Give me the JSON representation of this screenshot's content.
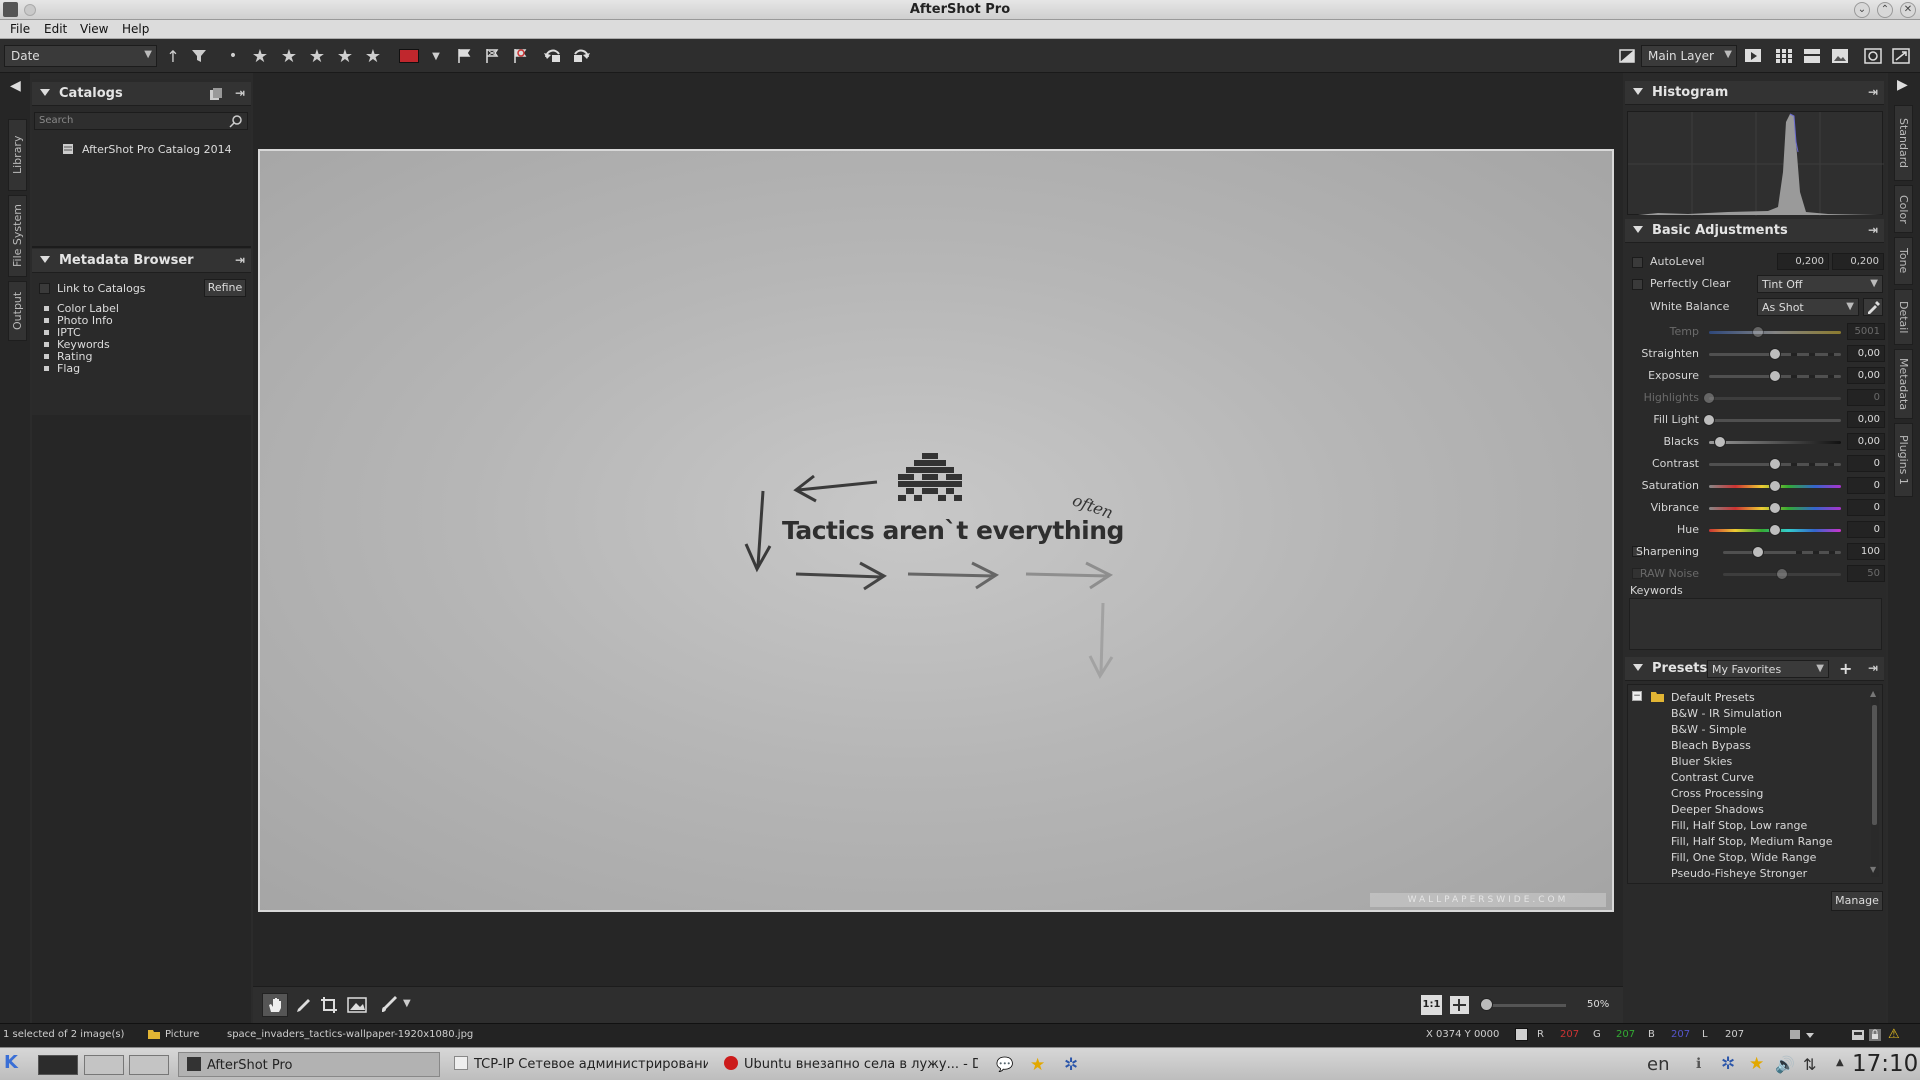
{
  "window": {
    "title": "AfterShot Pro"
  },
  "menu": [
    "File",
    "Edit",
    "View",
    "Help"
  ],
  "toolbar": {
    "sort_value": "Date",
    "layer_value": "Main Layer",
    "label_color": "#c0272d"
  },
  "left_tabs": [
    "Library",
    "File System",
    "Output"
  ],
  "right_tabs": [
    "Standard",
    "Color",
    "Tone",
    "Detail",
    "Metadata",
    "Plugins 1"
  ],
  "catalogs": {
    "title": "Catalogs",
    "search_placeholder": "Search",
    "items": [
      "AfterShot Pro Catalog 2014"
    ]
  },
  "metadata_browser": {
    "title": "Metadata Browser",
    "link_label": "Link to Catalogs",
    "refine_label": "Refine",
    "items": [
      "Color Label",
      "Photo Info",
      "IPTC",
      "Keywords",
      "Rating",
      "Flag"
    ]
  },
  "image": {
    "tagline": "Tactics aren`t everything",
    "often": "often",
    "watermark": "WALLPAPERSWIDE.COM"
  },
  "histogram": {
    "title": "Histogram"
  },
  "basic_adjustments": {
    "title": "Basic Adjustments",
    "autolevel": {
      "label": "AutoLevel",
      "v1": "0,200",
      "v2": "0,200"
    },
    "perfectly_clear": {
      "label": "Perfectly Clear",
      "value": "Tint Off"
    },
    "white_balance": {
      "label": "White Balance",
      "value": "As Shot"
    },
    "sliders": [
      {
        "label": "Temp",
        "value": "5001",
        "pos": 0.37,
        "dim": true
      },
      {
        "label": "Straighten",
        "value": "0,00",
        "pos": 0.5
      },
      {
        "label": "Exposure",
        "value": "0,00",
        "pos": 0.5
      },
      {
        "label": "Highlights",
        "value": "0",
        "pos": 0.0,
        "dim": true
      },
      {
        "label": "Fill Light",
        "value": "0,00",
        "pos": 0.0
      },
      {
        "label": "Blacks",
        "value": "0,00",
        "pos": 0.08
      },
      {
        "label": "Contrast",
        "value": "0",
        "pos": 0.5
      },
      {
        "label": "Saturation",
        "value": "0",
        "pos": 0.5
      },
      {
        "label": "Vibrance",
        "value": "0",
        "pos": 0.5
      },
      {
        "label": "Hue",
        "value": "0",
        "pos": 0.5
      },
      {
        "label": "Sharpening",
        "value": "100",
        "pos": 0.3
      },
      {
        "label": "RAW Noise",
        "value": "50",
        "pos": 0.5,
        "dim": true
      }
    ],
    "keywords_label": "Keywords"
  },
  "presets": {
    "title": "Presets",
    "filter_value": "My Favorites",
    "folder": "Default Presets",
    "items": [
      "B&W - IR Simulation",
      "B&W - Simple",
      "Bleach Bypass",
      "Bluer Skies",
      "Contrast Curve",
      "Cross Processing",
      "Deeper Shadows",
      "Fill, Half Stop, Low range",
      "Fill, Half Stop, Medium Range",
      "Fill, One Stop, Wide Range",
      "Pseudo-Fisheye Stronger"
    ],
    "manage_label": "Manage"
  },
  "bottom_toolbar": {
    "zoom": "50%",
    "one_to_one": "1:1"
  },
  "status": {
    "selection": "1 selected of 2 image(s)",
    "folder": "Picture",
    "filename": "space_invaders_tactics-wallpaper-1920x1080.jpg",
    "coords": "X 0374  Y 0000",
    "r_label": "R",
    "r": "207",
    "g_label": "G",
    "g": "207",
    "b_label": "B",
    "b": "207",
    "l_label": "L",
    "l": "207"
  },
  "taskbar": {
    "tasks": [
      "AfterShot Pro",
      "TCP-IP Сетевое администрирование,",
      "Ubuntu внезапно села в лужу... - Deskt"
    ],
    "lang": "en",
    "clock": "17:10"
  }
}
